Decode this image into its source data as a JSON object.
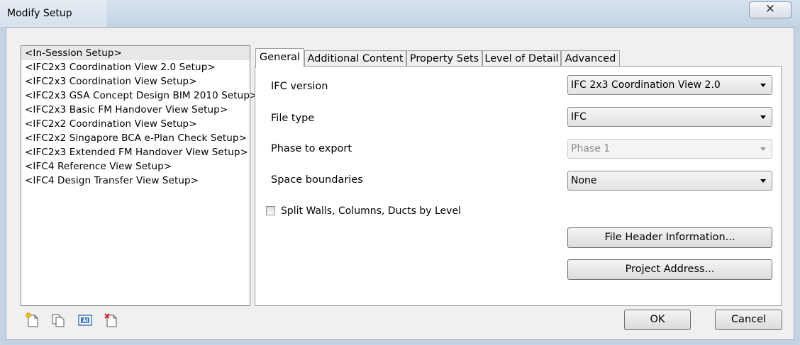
{
  "window": {
    "title": "Modify Setup",
    "close_glyph": "✕"
  },
  "setups": [
    "<In-Session Setup>",
    "<IFC2x3 Coordination View 2.0 Setup>",
    "<IFC2x3 Coordination View Setup>",
    "<IFC2x3 GSA Concept Design BIM 2010 Setup>",
    "<IFC2x3 Basic FM Handover View Setup>",
    "<IFC2x2 Coordination View Setup>",
    "<IFC2x2 Singapore BCA e-Plan Check Setup>",
    "<IFC2x3 Extended FM Handover View Setup>",
    "<IFC4 Reference View Setup>",
    "<IFC4 Design Transfer View Setup>"
  ],
  "toolbar_icons": [
    "new-setup-icon",
    "duplicate-setup-icon",
    "rename-setup-icon",
    "delete-setup-icon"
  ],
  "tabs": [
    "General",
    "Additional Content",
    "Property Sets",
    "Level of Detail",
    "Advanced"
  ],
  "general": {
    "ifc_version_label": "IFC version",
    "ifc_version_value": "IFC 2x3 Coordination View 2.0",
    "file_type_label": "File type",
    "file_type_value": "IFC",
    "phase_label": "Phase to export",
    "phase_value": "Phase 1",
    "space_label": "Space boundaries",
    "space_value": "None",
    "split_label": "Split Walls, Columns, Ducts by Level",
    "file_header_button": "File Header Information...",
    "project_address_button": "Project Address..."
  },
  "footer": {
    "ok": "OK",
    "cancel": "Cancel"
  }
}
